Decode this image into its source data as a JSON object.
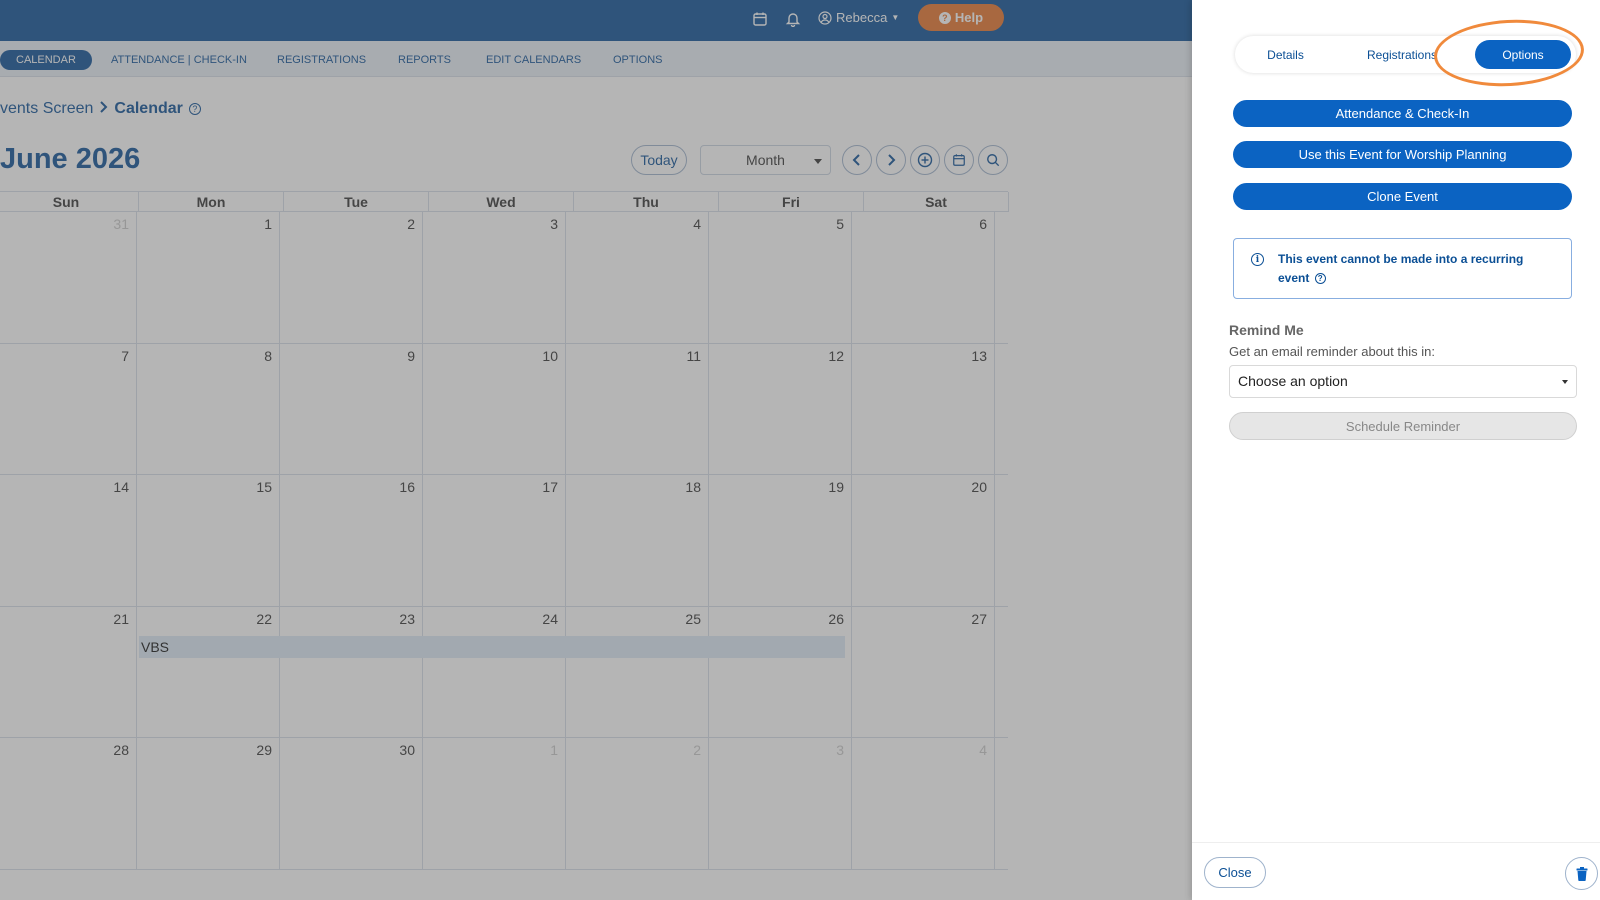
{
  "topbar": {
    "user_name": "Rebecca",
    "help_label": "Help",
    "icons": [
      "calendar-icon",
      "bell-icon",
      "user-circle-icon"
    ]
  },
  "nav": {
    "items": [
      "CALENDAR",
      "ATTENDANCE | CHECK-IN",
      "REGISTRATIONS",
      "REPORTS",
      "EDIT CALENDARS",
      "OPTIONS"
    ],
    "active": "CALENDAR"
  },
  "breadcrumb": {
    "parent": "vents Screen",
    "current": "Calendar"
  },
  "calendar": {
    "month_title": "June 2026",
    "today_label": "Today",
    "view_label": "Month",
    "days_of_week": [
      "Sun",
      "Mon",
      "Tue",
      "Wed",
      "Thu",
      "Fri",
      "Sat"
    ],
    "weeks": [
      [
        {
          "d": "31",
          "m": true
        },
        {
          "d": "1"
        },
        {
          "d": "2"
        },
        {
          "d": "3"
        },
        {
          "d": "4"
        },
        {
          "d": "5"
        },
        {
          "d": "6"
        }
      ],
      [
        {
          "d": "7"
        },
        {
          "d": "8"
        },
        {
          "d": "9"
        },
        {
          "d": "10"
        },
        {
          "d": "11"
        },
        {
          "d": "12"
        },
        {
          "d": "13"
        }
      ],
      [
        {
          "d": "14"
        },
        {
          "d": "15"
        },
        {
          "d": "16"
        },
        {
          "d": "17"
        },
        {
          "d": "18"
        },
        {
          "d": "19"
        },
        {
          "d": "20"
        }
      ],
      [
        {
          "d": "21"
        },
        {
          "d": "22"
        },
        {
          "d": "23"
        },
        {
          "d": "24"
        },
        {
          "d": "25"
        },
        {
          "d": "26"
        },
        {
          "d": "27"
        }
      ],
      [
        {
          "d": "28"
        },
        {
          "d": "29"
        },
        {
          "d": "30"
        },
        {
          "d": "1",
          "m": true
        },
        {
          "d": "2",
          "m": true
        },
        {
          "d": "3",
          "m": true
        },
        {
          "d": "4",
          "m": true
        }
      ]
    ],
    "event": {
      "label": "VBS",
      "week_index": 3
    }
  },
  "panel": {
    "tabs": [
      "Details",
      "Registrations",
      "Options"
    ],
    "active_tab": "Options",
    "actions": [
      "Attendance & Check-In",
      "Use this Event for Worship Planning",
      "Clone Event"
    ],
    "info_text": "This event cannot be made into a recurring event",
    "remind": {
      "title": "Remind Me",
      "description": "Get an email reminder about this in:",
      "select_value": "Choose an option",
      "schedule_label": "Schedule Reminder"
    },
    "close_label": "Close"
  },
  "colors": {
    "brand_blue": "#0b4f95",
    "button_blue": "#0b63c2",
    "help_orange": "#e8742a",
    "highlight_orange": "#f08a3c"
  }
}
